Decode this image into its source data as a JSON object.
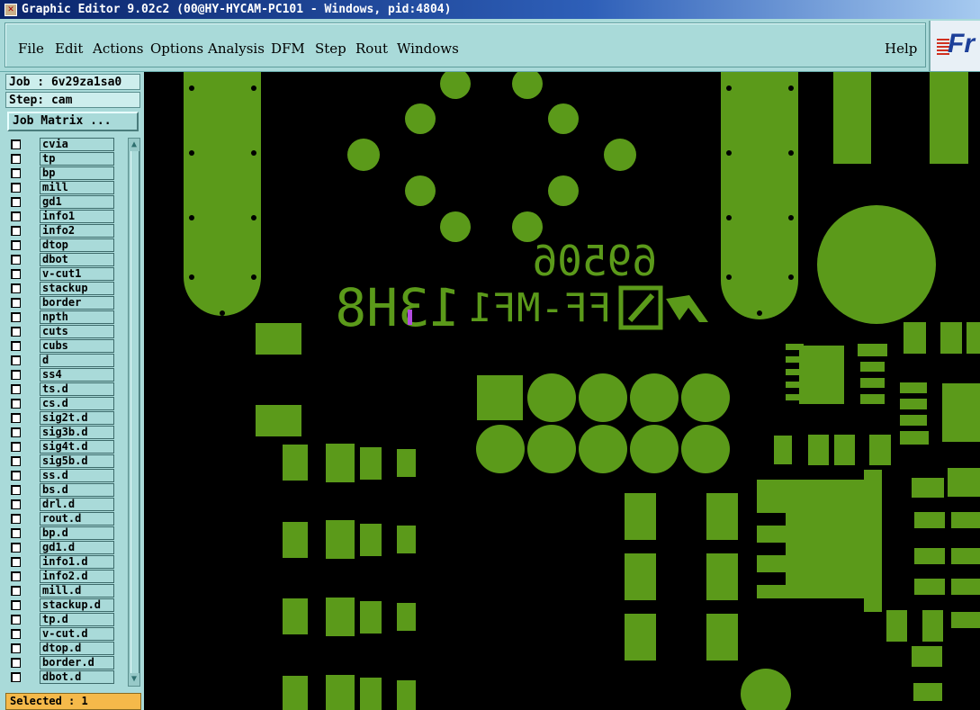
{
  "window": {
    "title": "Graphic Editor 9.02c2 (00@HY-HYCAM-PC101 - Windows, pid:4804)"
  },
  "menu": {
    "items": [
      {
        "label": "File"
      },
      {
        "label": "Edit"
      },
      {
        "label": "Actions"
      },
      {
        "label": "Options"
      },
      {
        "label": "Analysis"
      },
      {
        "label": "DFM"
      },
      {
        "label": "Step"
      },
      {
        "label": "Rout"
      },
      {
        "label": "Windows"
      }
    ],
    "help": "Help",
    "logo_text": "Fr"
  },
  "job": {
    "job_label": "Job : 6v29za1sa0",
    "step_label": "Step: cam",
    "matrix_button": "Job Matrix ..."
  },
  "layers": [
    "cvia",
    "tp",
    "bp",
    "mill",
    "gd1",
    "info1",
    "info2",
    "dtop",
    "dbot",
    "v-cut1",
    "stackup",
    "border",
    "npth",
    "cuts",
    "cubs",
    "d",
    "ss4",
    "ts.d",
    "cs.d",
    "sig2t.d",
    "sig3b.d",
    "sig4t.d",
    "sig5b.d",
    "ss.d",
    "bs.d",
    "drl.d",
    "rout.d",
    "bp.d",
    "gd1.d",
    "info1.d",
    "info2.d",
    "mill.d",
    "stackup.d",
    "tp.d",
    "v-cut.d",
    "dtop.d",
    "border.d",
    "dbot.d"
  ],
  "status": {
    "selected": "Selected : 1"
  },
  "canvas": {
    "silk_number": "69506",
    "silk_code": "FF-MF1",
    "silk_date": "13H8",
    "copper_color": "#5b9a1a",
    "highlight_color": "#b44ce0"
  }
}
